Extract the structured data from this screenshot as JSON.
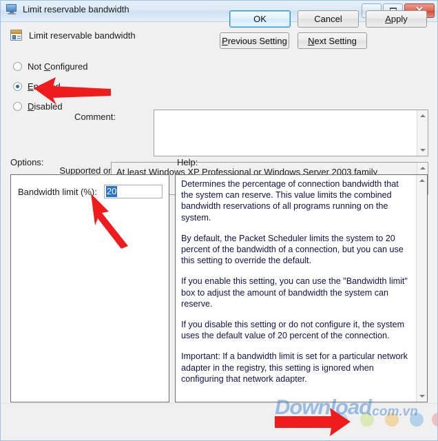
{
  "window": {
    "title": "Limit reservable bandwidth",
    "icon": "monitor-icon",
    "controls": {
      "minimize": "–",
      "maximize": "□",
      "close": "✕"
    }
  },
  "header": {
    "policy_name": "Limit reservable bandwidth",
    "policy_icon": "policy-setting-icon",
    "previous_setting": "Previous Setting",
    "previous_accel": "P",
    "next_setting": "Next Setting",
    "next_accel": "N"
  },
  "state": {
    "options": [
      {
        "label": "Not Configured",
        "accel": "C",
        "prefix": "Not ",
        "suffix": "onfigured",
        "selected": false
      },
      {
        "label": "Enabled",
        "accel": "E",
        "prefix": "",
        "suffix": "nabled",
        "selected": true
      },
      {
        "label": "Disabled",
        "accel": "D",
        "prefix": "",
        "suffix": "isabled",
        "selected": false
      }
    ],
    "comment_label": "Comment:",
    "comment_value": "",
    "supported_label": "Supported on:",
    "supported_value": "At least Windows XP Professional or Windows Server 2003 family"
  },
  "options_panel": {
    "label": "Options:",
    "bandwidth_label": "Bandwidth limit (%):",
    "bandwidth_value": "20",
    "bandwidth_selected": true
  },
  "help_panel": {
    "label": "Help:",
    "paragraphs": [
      "Determines the percentage of connection bandwidth that the system can reserve. This value limits the combined bandwidth reservations of all programs running on the system.",
      "By default, the Packet Scheduler limits the system to 20 percent of the bandwidth of a connection, but you can use this setting to override the default.",
      "If you enable this setting, you can use the \"Bandwidth limit\" box to adjust the amount of bandwidth the system can reserve.",
      "If you disable this setting or do not configure it, the system uses the default value of 20 percent of the connection.",
      "Important: If a bandwidth limit is set for a particular network adapter in the registry, this setting is ignored when configuring that network adapter."
    ]
  },
  "footer": {
    "ok": "OK",
    "cancel": "Cancel",
    "apply": "Apply",
    "apply_accel": "A",
    "default_button": "OK"
  },
  "watermark": {
    "main": "Download",
    "sub": ".com.vn"
  },
  "annotations": {
    "arrow_color": "#EE1C1C",
    "arrows": [
      {
        "target": "Enabled radio button",
        "direction": "left"
      },
      {
        "target": "Bandwidth limit input",
        "direction": "up-left"
      },
      {
        "target": "OK button",
        "direction": "right"
      }
    ]
  }
}
